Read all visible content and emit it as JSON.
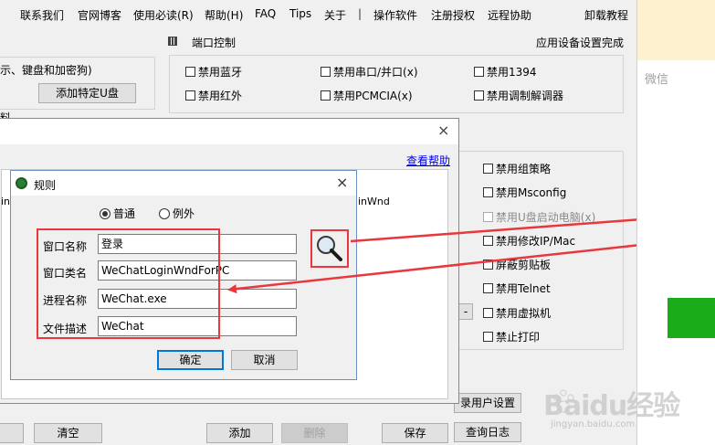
{
  "menu": {
    "items": [
      "联系我们",
      "官网博客",
      "使用必读(R)",
      "帮助(H)",
      "FAQ",
      "Tips",
      "关于",
      "操作软件",
      "注册授权",
      "远程协助",
      "卸载教程"
    ],
    "separator": "|"
  },
  "main": {
    "usb_group_label": "示、键盘和加密狗)",
    "add_usb_button": "添加特定U盘",
    "partial_label": "料",
    "port_control_label": "端口控制",
    "apply_done_label": "应用设备设置完成",
    "port_checkboxes": [
      "禁用蓝牙",
      "禁用串口/并口(x)",
      "禁用1394",
      "禁用红外",
      "禁用PCMCIA(x)",
      "禁用调制解调器"
    ],
    "system_checkboxes": [
      "禁用组策略",
      "禁用Msconfig",
      "禁用U盘启动电脑(x)",
      "禁用修改IP/Mac",
      "屏蔽剪贴板",
      "禁用Telnet",
      "禁用虚拟机",
      "禁止打印"
    ],
    "login_user_settings_button": "录用户设置",
    "view_log_button": "查询日志",
    "small_button": "-",
    "bottom_buttons": {
      "clear": "清空",
      "add": "添加",
      "delete": "删除",
      "save": "保存"
    }
  },
  "outer_dialog": {
    "help_link": "查看帮助",
    "partial_text_left": "in",
    "partial_text_right": "inWnd",
    "close_glyph": "×"
  },
  "rule_dialog": {
    "title": "规则",
    "close_glyph": "×",
    "radio_normal": "普通",
    "radio_exception": "例外",
    "fields": [
      {
        "label": "窗口名称",
        "value": "登录"
      },
      {
        "label": "窗口类名",
        "value": "WeChatLoginWndForPC"
      },
      {
        "label": "进程名称",
        "value": "WeChat.exe"
      },
      {
        "label": "文件描述",
        "value": "WeChat"
      }
    ],
    "ok_button": "确定",
    "cancel_button": "取消"
  },
  "right_panel": {
    "title": "微信"
  },
  "watermark": {
    "brand": "Baidu经验",
    "url": "jingyan.baidu.com"
  },
  "colors": {
    "annotation_red": "#e8383d",
    "wechat_green": "#1aad19",
    "link_blue": "#0000ee"
  }
}
